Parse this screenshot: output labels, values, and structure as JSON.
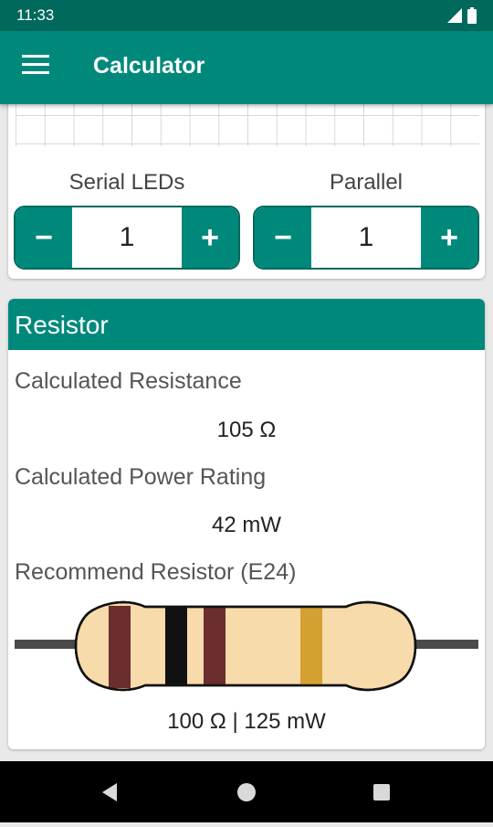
{
  "status": {
    "time": "11:33"
  },
  "app_bar": {
    "title": "Calculator",
    "menu_icon": "hamburger-menu-icon"
  },
  "leds": {
    "serial": {
      "label": "Serial LEDs",
      "value": "1",
      "minus": "−",
      "plus": "+"
    },
    "parallel": {
      "label": "Parallel",
      "value": "1",
      "minus": "−",
      "plus": "+"
    }
  },
  "resistor": {
    "title": "Resistor",
    "resistance_label": "Calculated Resistance",
    "resistance_value": "105 Ω",
    "power_label": "Calculated Power Rating",
    "power_value": "42 mW",
    "recommend_label": "Recommend Resistor (E24)",
    "recommend_value": "100 Ω | 125 mW",
    "colors": {
      "body": "#f8dbab",
      "band1": "#6b2d2d",
      "band2": "#111111",
      "band3": "#6b2d2d",
      "tolerance": "#d4a032",
      "lead": "#4a4a4a"
    }
  },
  "colors": {
    "accent": "#00897b",
    "accent_dark": "#00695c"
  },
  "nav": {
    "back_icon": "back-icon",
    "home_icon": "home-icon",
    "recents_icon": "recents-icon"
  }
}
